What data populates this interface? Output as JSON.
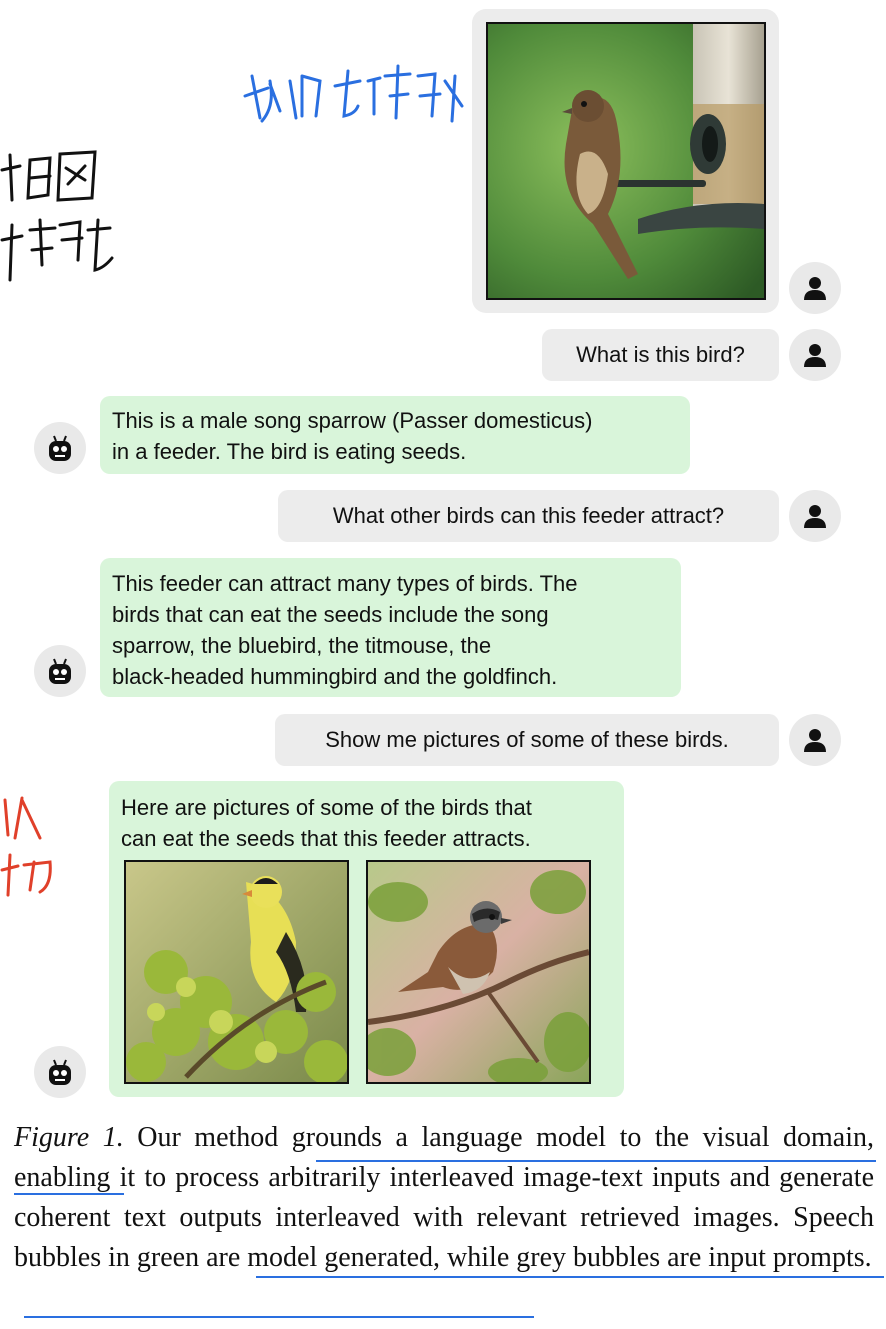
{
  "conversation": [
    {
      "role": "user",
      "type": "image",
      "image_name": "sparrow-at-feeder-photo"
    },
    {
      "role": "user",
      "type": "text",
      "text": "What is this bird?"
    },
    {
      "role": "model",
      "type": "text",
      "lines": [
        "This is a male song sparrow (Passer domesticus)",
        "in a feeder. The bird is eating seeds."
      ]
    },
    {
      "role": "user",
      "type": "text",
      "text": "What other birds can this feeder attract?"
    },
    {
      "role": "model",
      "type": "text",
      "lines": [
        "This feeder can attract many types of birds. The",
        "birds that can eat the seeds include the song",
        "sparrow, the bluebird, the titmouse, the",
        "black-headed hummingbird and the goldfinch."
      ]
    },
    {
      "role": "user",
      "type": "text",
      "text": "Show me pictures of some of these birds."
    },
    {
      "role": "model",
      "type": "text+images",
      "lines": [
        "Here are pictures of some of the birds that",
        "can eat the seeds that this feeder attracts."
      ],
      "images": [
        "goldfinch-photo",
        "sparrow-on-branch-photo"
      ]
    }
  ],
  "caption": {
    "figure_label": "Figure 1.",
    "text": " Our method grounds a language model to the visual domain, enabling it to process arbitrarily interleaved image-text inputs and generate coherent text outputs interleaved with relevant retrieved images. Speech bubbles in green are model generated, while grey bubbles are input prompts."
  },
  "annotations": {
    "handwriting_color_blue": "#2a6fe0",
    "handwriting_color_red": "#e0402a",
    "underline_color": "#2a6fe0"
  },
  "icons": {
    "user_avatar": "person-icon",
    "model_avatar": "robot-icon"
  }
}
